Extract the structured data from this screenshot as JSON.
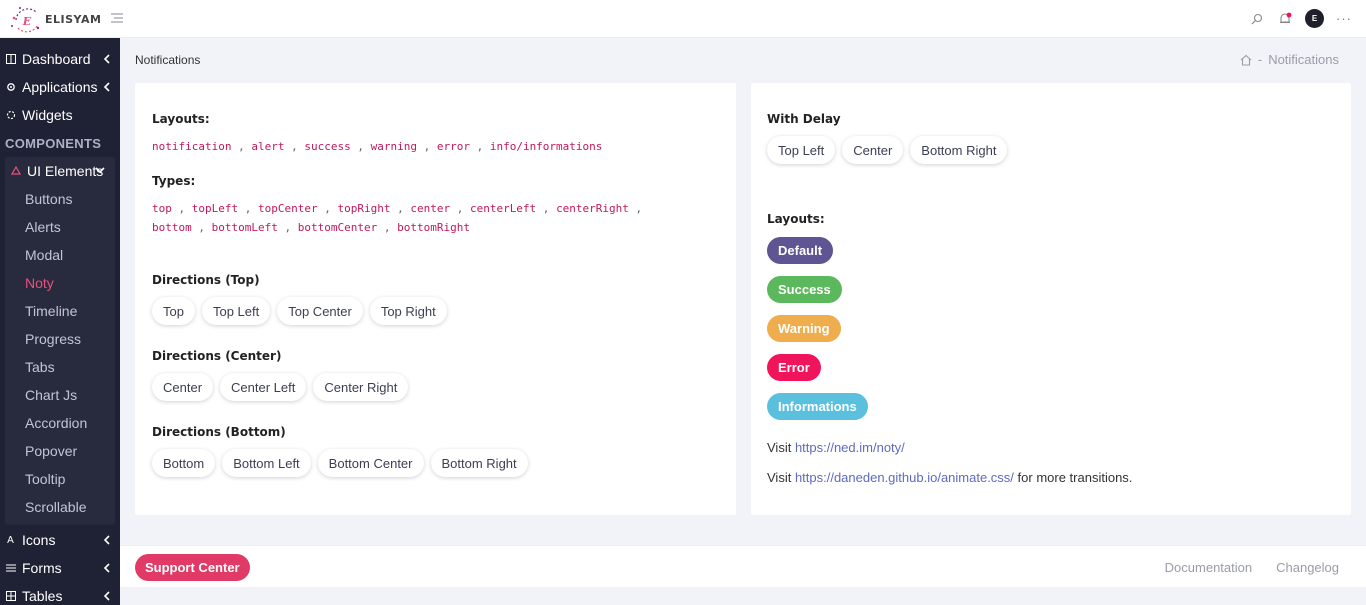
{
  "brand": {
    "name": "ELISYAM",
    "logo_letter": "E"
  },
  "header": {
    "avatar_initial": "E",
    "more_label": "···",
    "search_icon": "search-icon",
    "notifications_icon": "bell-icon"
  },
  "sidebar": {
    "top_items": [
      {
        "label": "Dashboard",
        "icon": "columns-icon"
      },
      {
        "label": "Applications",
        "icon": "gear-icon"
      },
      {
        "label": "Widgets",
        "icon": "widgets-icon"
      }
    ],
    "section_label": "COMPONENTS",
    "group": {
      "label": "UI Elements",
      "items": [
        "Buttons",
        "Alerts",
        "Modal",
        "Noty",
        "Timeline",
        "Progress",
        "Tabs",
        "Chart Js",
        "Accordion",
        "Popover",
        "Tooltip",
        "Scrollable"
      ],
      "active": "Noty"
    },
    "bottom_items": [
      {
        "label": "Icons",
        "icon": "letter-a-icon"
      },
      {
        "label": "Forms",
        "icon": "list-icon"
      },
      {
        "label": "Tables",
        "icon": "grid-icon"
      }
    ]
  },
  "page": {
    "title": "Notifications",
    "breadcrumb_current": "Notifications",
    "breadcrumb_sep": "-"
  },
  "left_card": {
    "layouts_heading": "Layouts:",
    "layouts": [
      "notification",
      "alert",
      "success",
      "warning",
      "error",
      "info/informations"
    ],
    "types_heading": "Types:",
    "types_line1": [
      "top",
      "topLeft",
      "topCenter",
      "topRight",
      "center",
      "centerLeft",
      "centerRight"
    ],
    "types_line2": [
      "bottom",
      "bottomLeft",
      "bottomCenter",
      "bottomRight"
    ],
    "directions_top": {
      "heading": "Directions (Top)",
      "buttons": [
        "Top",
        "Top Left",
        "Top Center",
        "Top Right"
      ]
    },
    "directions_center": {
      "heading": "Directions (Center)",
      "buttons": [
        "Center",
        "Center Left",
        "Center Right"
      ]
    },
    "directions_bottom": {
      "heading": "Directions (Bottom)",
      "buttons": [
        "Bottom",
        "Bottom Left",
        "Bottom Center",
        "Bottom Right"
      ]
    }
  },
  "right_card": {
    "delay_heading": "With Delay",
    "delay_buttons": [
      "Top Left",
      "Center",
      "Bottom Right"
    ],
    "layouts_heading": "Layouts:",
    "layout_badges": [
      {
        "label": "Default",
        "color": "#5e5592"
      },
      {
        "label": "Success",
        "color": "#5cb85c"
      },
      {
        "label": "Warning",
        "color": "#f0ad4e"
      },
      {
        "label": "Error",
        "color": "#f0145a"
      },
      {
        "label": "Informations",
        "color": "#5bc0de"
      }
    ],
    "visit1": {
      "prefix": "Visit ",
      "link": "https://ned.im/noty/"
    },
    "visit2": {
      "prefix": "Visit ",
      "link": "https://daneden.github.io/animate.css/",
      "suffix": " for more transitions."
    }
  },
  "footer": {
    "support_label": "Support Center",
    "links": [
      "Documentation",
      "Changelog"
    ]
  },
  "colors": {
    "sidebar_bg": "#1f2134",
    "accent": "#ea4f7c",
    "code": "#c2185b"
  }
}
